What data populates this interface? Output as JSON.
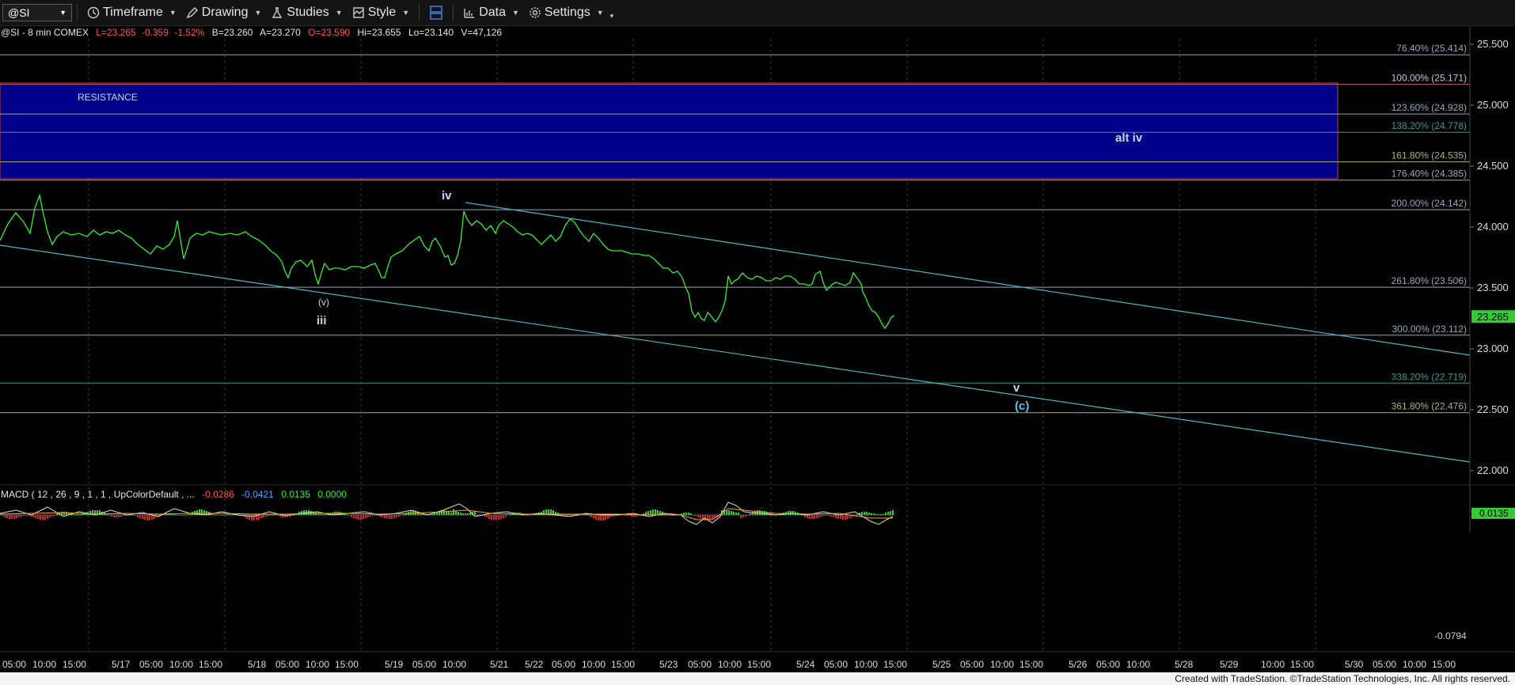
{
  "toolbar": {
    "symbol": "@SI",
    "timeframe_label": "Timeframe",
    "drawing_label": "Drawing",
    "studies_label": "Studies",
    "style_label": "Style",
    "data_label": "Data",
    "settings_label": "Settings"
  },
  "header": {
    "symbol_info": "@SI - 8 min  COMEX",
    "last": "L=23.265",
    "change": "-0.359",
    "change_pct": "-1.52%",
    "bid": "B=23.260",
    "ask": "A=23.270",
    "open": "O=23.590",
    "high": "Hi=23.655",
    "low": "Lo=23.140",
    "volume": "V=47,126"
  },
  "resistance_label": "RESISTANCE",
  "waves": {
    "iv": "iv",
    "v_small": "(v)",
    "iii": "iii",
    "alt_iv": "alt iv",
    "v": "v",
    "c": "(c)"
  },
  "fib_levels": [
    {
      "label": "76.40% (25.414)",
      "price": 25.414,
      "color": "#9aa6bf"
    },
    {
      "label": "100.00% (25.171)",
      "price": 25.171,
      "color": "#c06060"
    },
    {
      "label": "123.60% (24.928)",
      "price": 24.928,
      "color": "#9aa6bf"
    },
    {
      "label": "138.20% (24.778)",
      "price": 24.778,
      "color": "#3a9a8a"
    },
    {
      "label": "161.80% (24.535)",
      "price": 24.535,
      "color": "#b0b070"
    },
    {
      "label": "176.40% (24.385)",
      "price": 24.385,
      "color": "#9aa6bf"
    },
    {
      "label": "200.00% (24.142)",
      "price": 24.142,
      "color": "#9aa6bf"
    },
    {
      "label": "261.80% (23.506)",
      "price": 23.506,
      "color": "#9aa6bf"
    },
    {
      "label": "300.00% (23.112)",
      "price": 23.112,
      "color": "#9aa6bf"
    },
    {
      "label": "338.20% (22.719)",
      "price": 22.719,
      "color": "#3a9a8a"
    },
    {
      "label": "361.80% (22.476)",
      "price": 22.476,
      "color": "#b0b070"
    }
  ],
  "price_axis": {
    "ticks": [
      "25.500",
      "25.000",
      "24.500",
      "24.000",
      "23.500",
      "23.000",
      "22.500",
      "22.000"
    ],
    "tick_values": [
      25.5,
      25.0,
      24.5,
      24.0,
      23.5,
      23.0,
      22.5,
      22.0
    ],
    "last_price": "23.265",
    "last_value": 23.265
  },
  "macd": {
    "label": "MACD ( 12 , 26 , 9 , 1 , 1 , UpColorDefault , ...",
    "v1": "-0.0286",
    "v2": "-0.0421",
    "v3": "0.0135",
    "v4": "0.0000",
    "axis_value": "0.0135",
    "axis_low": "-0.0794"
  },
  "time_axis": {
    "labels": [
      "05:00",
      "10:00",
      "15:00",
      "5/17",
      "05:00",
      "10:00",
      "15:00",
      "5/18",
      "05:00",
      "10:00",
      "15:00",
      "5/19",
      "05:00",
      "10:00",
      "5/21",
      "5/22",
      "05:00",
      "10:00",
      "15:00",
      "5/23",
      "05:00",
      "10:00",
      "15:00",
      "5/24",
      "05:00",
      "10:00",
      "15:00",
      "5/25",
      "05:00",
      "10:00",
      "15:00",
      "5/26",
      "05:00",
      "10:00",
      "5/28",
      "5/29",
      "10:00",
      "15:00",
      "5/30",
      "05:00",
      "10:00",
      "15:00"
    ]
  },
  "footer_text": "Created with TradeStation. ©TradeStation Technologies, Inc. All rights reserved.",
  "colors": {
    "price_line": "#33ee33",
    "resistance_fill": "#00008b",
    "channel": "#4fb5c4",
    "last_price_bg": "#33cc33",
    "label_blue": "#c8d8f0",
    "wave_c": "#4fc8e8"
  }
}
